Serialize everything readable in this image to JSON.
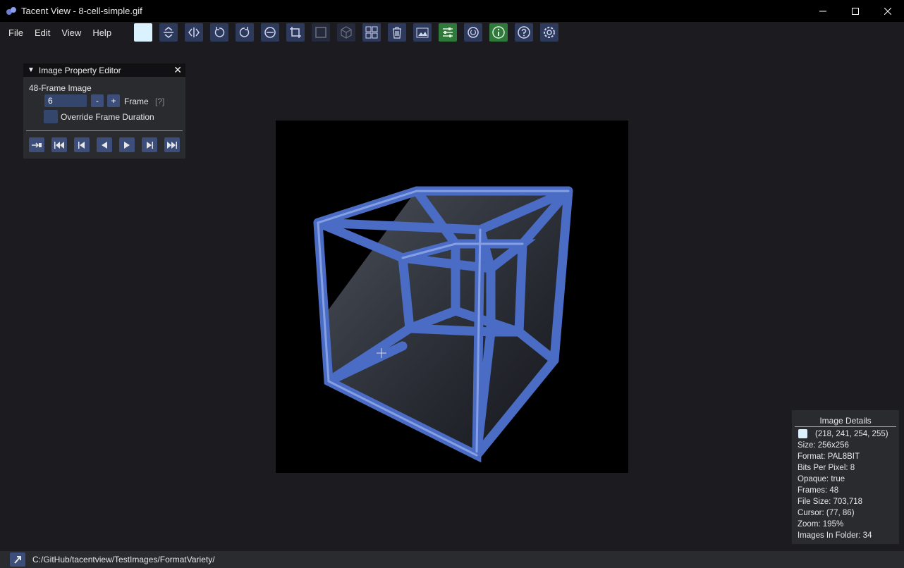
{
  "window": {
    "title": "Tacent View - 8-cell-simple.gif"
  },
  "menu": {
    "file": "File",
    "edit": "Edit",
    "view": "View",
    "help": "Help"
  },
  "toolbar": {
    "icons": [
      "color-swatch",
      "flip-vertical-icon",
      "flip-horizontal-icon",
      "rotate-ccw-icon",
      "rotate-cw-icon",
      "rotate-theta-icon",
      "crop-icon",
      "border-icon",
      "cube-icon",
      "contact-sheet-icon",
      "delete-icon",
      "save-as-icon",
      "settings-sliders-icon",
      "refresh-icon",
      "info-icon",
      "help-icon",
      "preferences-icon"
    ],
    "swatch_color": "#daf1fe"
  },
  "property_editor": {
    "title": "Image Property Editor",
    "frames_label": "48-Frame Image",
    "frame_value": "6",
    "minus_label": "-",
    "plus_label": "+",
    "frame_label": "Frame",
    "help_hint": "[?]",
    "override_label": "Override Frame Duration"
  },
  "details": {
    "header": "Image   Details",
    "color": "(218, 241, 254, 255)",
    "size": "Size: 256x256",
    "format": "Format: PAL8BIT",
    "bpp": "Bits Per Pixel: 8",
    "opaque": "Opaque: true",
    "frames": "Frames: 48",
    "file_size": "File Size: 703,718",
    "cursor": "Cursor: (77, 86)",
    "zoom": "Zoom: 195%",
    "images_in_folder": "Images In Folder: 34"
  },
  "status": {
    "path": "C:/GitHub/tacentview/TestImages/FormatVariety/"
  },
  "colors": {
    "accent": "#3e4e7a",
    "background": "#1c1c20",
    "panel": "#2a2b2e",
    "swatch": "#daf1fe"
  }
}
